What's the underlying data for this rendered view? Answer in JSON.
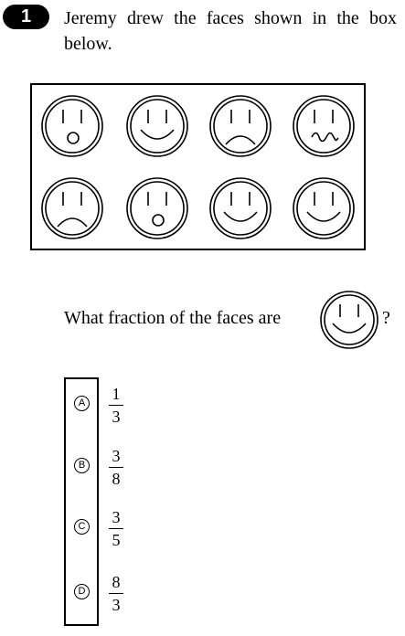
{
  "question": {
    "number": "1",
    "stem": "Jeremy drew the faces shown in the box below.",
    "prompt": "What fraction of the faces are",
    "prompt_end": "?"
  },
  "faces": [
    {
      "mouth": "open-o"
    },
    {
      "mouth": "smile"
    },
    {
      "mouth": "frown"
    },
    {
      "mouth": "squiggle"
    },
    {
      "mouth": "frown"
    },
    {
      "mouth": "open-o"
    },
    {
      "mouth": "smile"
    },
    {
      "mouth": "smile"
    }
  ],
  "choices": [
    {
      "letter": "A",
      "numerator": "1",
      "denominator": "3"
    },
    {
      "letter": "B",
      "numerator": "3",
      "denominator": "8"
    },
    {
      "letter": "C",
      "numerator": "3",
      "denominator": "5"
    },
    {
      "letter": "D",
      "numerator": "8",
      "denominator": "3"
    }
  ]
}
